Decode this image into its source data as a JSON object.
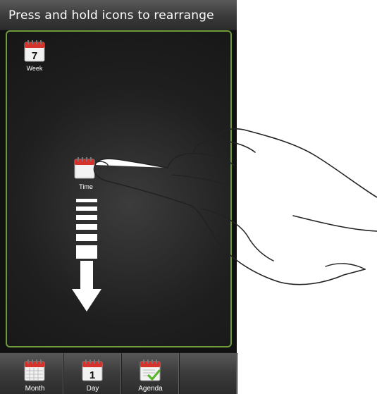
{
  "header": {
    "instruction": "Press and hold icons to rearrange"
  },
  "panel": {
    "icons": [
      {
        "label": "Week",
        "calendar_number": "7",
        "icon": "calendar-icon"
      },
      {
        "label": "Time",
        "icon": "calendar-icon"
      }
    ],
    "gesture": {
      "direction": "down",
      "icon": "hand-pointer-icon"
    }
  },
  "tabbar": {
    "tabs": [
      {
        "label": "Month",
        "icon": "calendar-grid-icon"
      },
      {
        "label": "Day",
        "calendar_number": "1",
        "icon": "calendar-icon"
      },
      {
        "label": "Agenda",
        "icon": "calendar-check-icon"
      },
      {
        "label": "",
        "icon": ""
      }
    ]
  },
  "colors": {
    "panel_border": "#6e9a3a",
    "calendar_red": "#d4322a",
    "checkmark_green": "#5bb52a"
  }
}
